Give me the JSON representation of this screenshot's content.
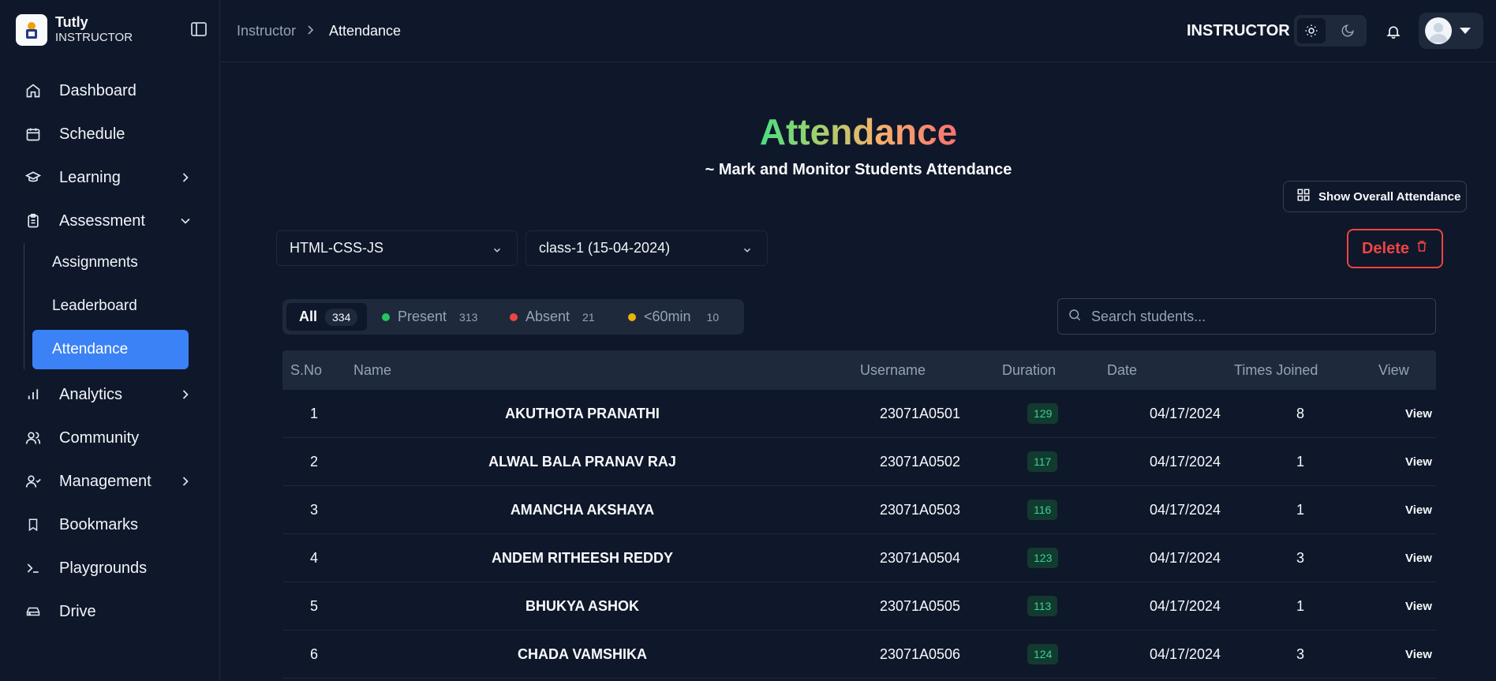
{
  "brand": {
    "name": "Tutly",
    "role": "INSTRUCTOR"
  },
  "sidebar": {
    "items": [
      {
        "label": "Dashboard",
        "icon": "home-icon"
      },
      {
        "label": "Schedule",
        "icon": "calendar-icon"
      },
      {
        "label": "Learning",
        "icon": "graduation-cap-icon"
      },
      {
        "label": "Assessment",
        "icon": "clipboard-icon"
      },
      {
        "label": "Analytics",
        "icon": "bar-chart-icon"
      },
      {
        "label": "Community",
        "icon": "users-icon"
      },
      {
        "label": "Management",
        "icon": "user-cog-icon"
      },
      {
        "label": "Bookmarks",
        "icon": "bookmark-icon"
      },
      {
        "label": "Playgrounds",
        "icon": "terminal-icon"
      },
      {
        "label": "Drive",
        "icon": "hard-drive-icon"
      }
    ],
    "assessment_sub": [
      {
        "label": "Assignments"
      },
      {
        "label": "Leaderboard"
      },
      {
        "label": "Attendance",
        "active": true
      }
    ]
  },
  "breadcrumb": {
    "parent": "Instructor",
    "current": "Attendance"
  },
  "header": {
    "role": "INSTRUCTOR"
  },
  "page": {
    "title": "Attendance",
    "subtitle": "~ Mark and Monitor Students Attendance",
    "overall_button": "Show Overall Attendance",
    "course_select": "HTML-CSS-JS",
    "class_select": "class-1 (15-04-2024)",
    "delete_button": "Delete"
  },
  "filters": {
    "all": {
      "label": "All",
      "count": "334"
    },
    "present": {
      "label": "Present",
      "count": "313",
      "color": "#22c55e"
    },
    "absent": {
      "label": "Absent",
      "count": "21",
      "color": "#ef4444"
    },
    "short": {
      "label": "<60min",
      "count": "10",
      "color": "#eab308"
    }
  },
  "search": {
    "placeholder": "Search students..."
  },
  "table": {
    "headers": [
      "S.No",
      "Name",
      "Username",
      "Duration",
      "Date",
      "Times Joined",
      "View"
    ],
    "rows": [
      {
        "sno": "1",
        "name": "AKUTHOTA PRANATHI",
        "username": "23071A0501",
        "duration": "129",
        "date": "04/17/2024",
        "joined": "8",
        "view": "View"
      },
      {
        "sno": "2",
        "name": "ALWAL BALA PRANAV RAJ",
        "username": "23071A0502",
        "duration": "117",
        "date": "04/17/2024",
        "joined": "1",
        "view": "View"
      },
      {
        "sno": "3",
        "name": "AMANCHA AKSHAYA",
        "username": "23071A0503",
        "duration": "116",
        "date": "04/17/2024",
        "joined": "1",
        "view": "View"
      },
      {
        "sno": "4",
        "name": "ANDEM RITHEESH REDDY",
        "username": "23071A0504",
        "duration": "123",
        "date": "04/17/2024",
        "joined": "3",
        "view": "View"
      },
      {
        "sno": "5",
        "name": "BHUKYA ASHOK",
        "username": "23071A0505",
        "duration": "113",
        "date": "04/17/2024",
        "joined": "1",
        "view": "View"
      },
      {
        "sno": "6",
        "name": "CHADA VAMSHIKA",
        "username": "23071A0506",
        "duration": "124",
        "date": "04/17/2024",
        "joined": "3",
        "view": "View"
      }
    ]
  }
}
